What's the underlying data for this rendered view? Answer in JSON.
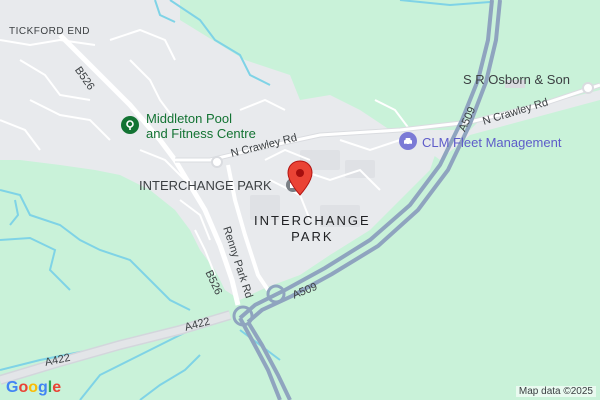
{
  "map": {
    "place_labels": {
      "tickford_end": "TICKFORD END",
      "interchange_park_biz": "INTERCHANGE PARK",
      "interchange_park_area_line1": "INTERCHANGE",
      "interchange_park_area_line2": "PARK"
    },
    "pois": {
      "middleton_pool": {
        "line1": "Middleton Pool",
        "line2": "and Fitness Centre",
        "color": "#137333",
        "icon": "fitness-place-icon"
      },
      "clm_fleet": {
        "name": "CLM Fleet Management",
        "color": "#5e5cc9",
        "icon": "car-service-icon"
      },
      "osborn": {
        "name": "S R Osborn & Son"
      }
    },
    "roads": {
      "b526_north": "B526",
      "b526_south": "B526",
      "n_crawley_west": "N Crawley Rd",
      "n_crawley_east": "N Crawley Rd",
      "renny_park": "Renny Park Rd",
      "a509_south": "A509",
      "a509_north": "A509",
      "a422": "A422"
    },
    "pin": {
      "icon": "location-pin-icon",
      "color": "#ea4335"
    },
    "colors": {
      "green_area": "#c9f2d9",
      "urban": "#e8eaed",
      "water": "#7fd3e6",
      "motorway": "#8fa4bf",
      "road": "#ffffff"
    }
  },
  "footer": {
    "logo": "Google",
    "attribution": "Map data ©2025"
  }
}
